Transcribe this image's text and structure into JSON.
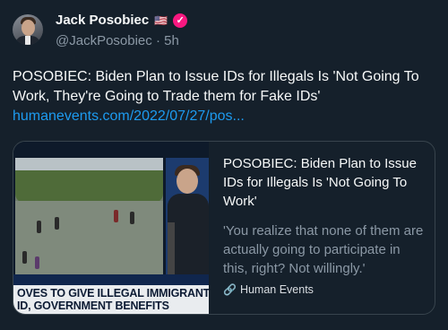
{
  "tweet": {
    "display_name": "Jack Posobiec",
    "flag": "🇺🇸",
    "handle": "@JackPosobiec",
    "separator": "·",
    "time": "5h",
    "text": "POSOBIEC: Biden Plan to Issue IDs for Illegals Is 'Not Going To Work, They're Going to Trade them for Fake IDs'",
    "link": "humanevents.com/2022/07/27/pos..."
  },
  "card": {
    "image_chyron_line1": "OVES TO GIVE ILLEGAL IMMIGRANTS",
    "image_chyron_line2": "ID, GOVERNMENT BENEFITS",
    "title": "POSOBIEC: Biden Plan to Issue IDs for Illegals Is 'Not Going To Work'",
    "description": "'You realize that none of them are actually going to participate in this, right? Not willingly.'",
    "source": "Human Events"
  },
  "icons": {
    "verified": "verified-badge-icon",
    "link": "link-icon"
  },
  "colors": {
    "background": "#15202b",
    "link": "#1d9bf0",
    "verified": "#f91880",
    "muted": "#8b98a5"
  }
}
